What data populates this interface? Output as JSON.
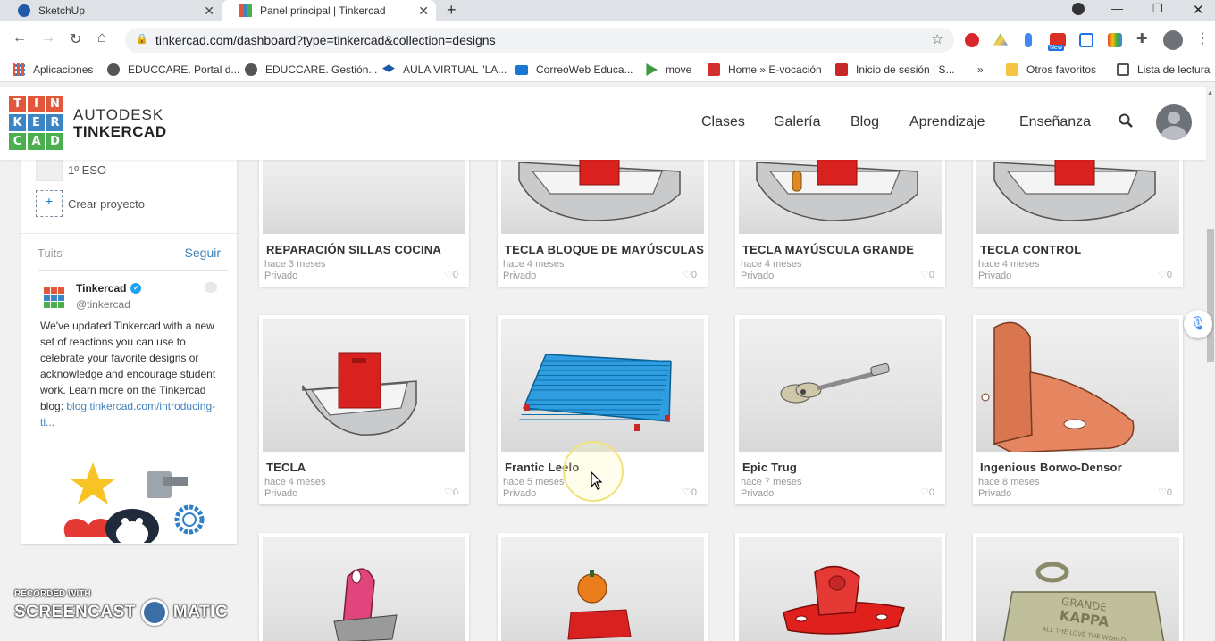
{
  "browser": {
    "tabs": [
      {
        "label": "SketchUp",
        "active": false
      },
      {
        "label": "Panel principal | Tinkercad",
        "active": true
      }
    ],
    "url": "tinkercad.com/dashboard?type=tinkercad&collection=designs",
    "extension_badge": "New",
    "bookmarks": [
      {
        "label": "Aplicaciones",
        "icon": "apps-grid-icon"
      },
      {
        "label": "EDUCCARE. Portal d...",
        "icon": "globe-icon"
      },
      {
        "label": "EDUCCARE. Gestión...",
        "icon": "globe-icon"
      },
      {
        "label": "AULA VIRTUAL \"LA...",
        "icon": "graduation-cap-icon"
      },
      {
        "label": "CorreoWeb Educa...",
        "icon": "mail-icon"
      },
      {
        "label": "move",
        "icon": "play-icon"
      },
      {
        "label": "Home » E-vocación",
        "icon": "e-logo-icon"
      },
      {
        "label": "Inicio de sesión | S...",
        "icon": "sm-logo-icon"
      }
    ],
    "overflow_label": "»",
    "other_favorites": "Otros favoritos",
    "reading_list": "Lista de lectura"
  },
  "header": {
    "logo_letters": [
      "T",
      "I",
      "N",
      "K",
      "E",
      "R",
      "C",
      "A",
      "D"
    ],
    "logo_colors": [
      "#e2573b",
      "#e2573b",
      "#e2573b",
      "#3d86c5",
      "#3d86c5",
      "#3d86c5",
      "#4bae4f",
      "#4bae4f",
      "#4bae4f"
    ],
    "brand_line1": "AUTODESK",
    "brand_line2": "TINKERCAD",
    "nav": [
      "Clases",
      "Galería",
      "Blog",
      "Aprendizaje",
      "Enseñanza"
    ]
  },
  "sidebar": {
    "projects": [
      {
        "label": "1º ESO"
      },
      {
        "label": "Crear proyecto"
      }
    ],
    "twitter": {
      "title": "Tuits",
      "follow": "Seguir",
      "name": "Tinkercad",
      "handle": "@tinkercad",
      "text": "We've updated Tinkercad with a new set of reactions you can use to celebrate your favorite designs or acknowledge and encourage student work. Learn more on the Tinkercad blog: ",
      "link": "blog.tinkercad.com/introducing-ti..."
    }
  },
  "designs": [
    {
      "title": "REPARACIÓN SILLAS COCINA",
      "date": "hace 3 meses",
      "privacy": "Privado",
      "likes": "0",
      "thumb": "blank"
    },
    {
      "title": "TECLA BLOQUE DE MAYÚSCULAS",
      "date": "hace 4 meses",
      "privacy": "Privado",
      "likes": "0",
      "thumb": "key"
    },
    {
      "title": "TECLA MAYÚSCULA GRANDE",
      "date": "hace 4 meses",
      "privacy": "Privado",
      "likes": "0",
      "thumb": "key-orange"
    },
    {
      "title": "TECLA CONTROL",
      "date": "hace 4 meses",
      "privacy": "Privado",
      "likes": "0",
      "thumb": "key"
    },
    {
      "title": "TECLA",
      "date": "hace 4 meses",
      "privacy": "Privado",
      "likes": "0",
      "thumb": "key-full"
    },
    {
      "title": "Frantic Leelo",
      "date": "hace 5 meses",
      "privacy": "Privado",
      "likes": "0",
      "thumb": "grid-plate"
    },
    {
      "title": "Epic Trug",
      "date": "hace 7 meses",
      "privacy": "Privado",
      "likes": "0",
      "thumb": "guitar"
    },
    {
      "title": "Ingenious Borwo-Densor",
      "date": "hace 8 meses",
      "privacy": "Privado",
      "likes": "0",
      "thumb": "bracket"
    },
    {
      "thumb": "pink-stand"
    },
    {
      "thumb": "pumpkin"
    },
    {
      "thumb": "red-clamp"
    },
    {
      "thumb": "keychain",
      "thumb_text": [
        "GRANDE",
        "KAPPA",
        "ALL THE LOVE THE WORLD"
      ]
    }
  ],
  "watermark": {
    "line1": "RECORDED WITH",
    "left": "SCREENCAST",
    "right": "MATIC"
  }
}
